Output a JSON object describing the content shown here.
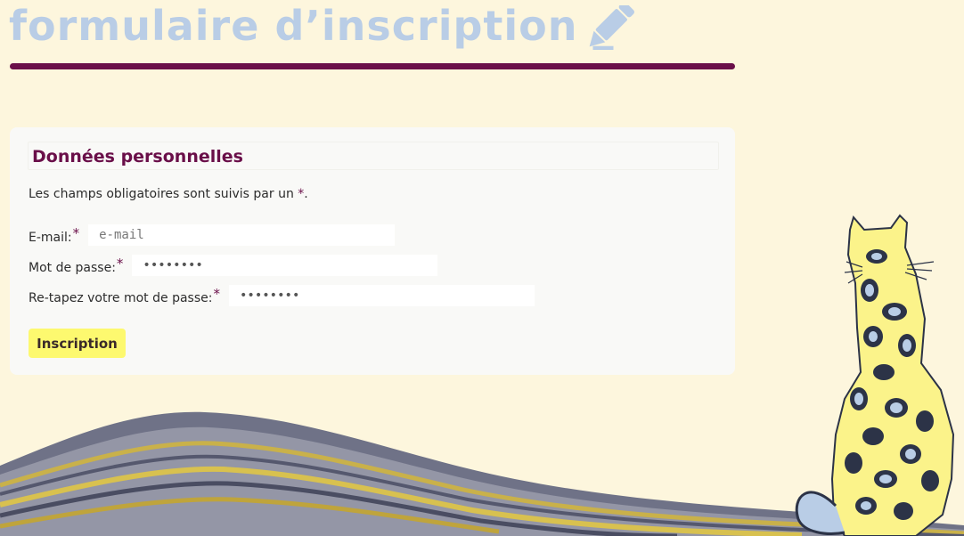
{
  "header": {
    "title": "formulaire d’inscription _"
  },
  "form": {
    "legend": "Données personnelles",
    "note_prefix": "Les champs obligatoires sont suivis par un ",
    "required_mark": "*",
    "note_suffix": ".",
    "fields": [
      {
        "label": "E-mail:",
        "type": "email",
        "placeholder": "e-mail",
        "value": ""
      },
      {
        "label": "Mot de passe:",
        "type": "password",
        "placeholder": "",
        "value": "••••••••"
      },
      {
        "label": "Re-tapez votre mot de passe:",
        "type": "password",
        "placeholder": "",
        "value": "••••••••"
      }
    ],
    "submit_label": "Inscription"
  },
  "colors": {
    "background": "#fdf6dd",
    "title": "#b9cde6",
    "accent": "#6a0f49",
    "button": "#fdf96f",
    "card": "#f9f9f7"
  },
  "icons": {
    "title_icon": "pencil-icon",
    "decoration": "leopard-illustration"
  }
}
